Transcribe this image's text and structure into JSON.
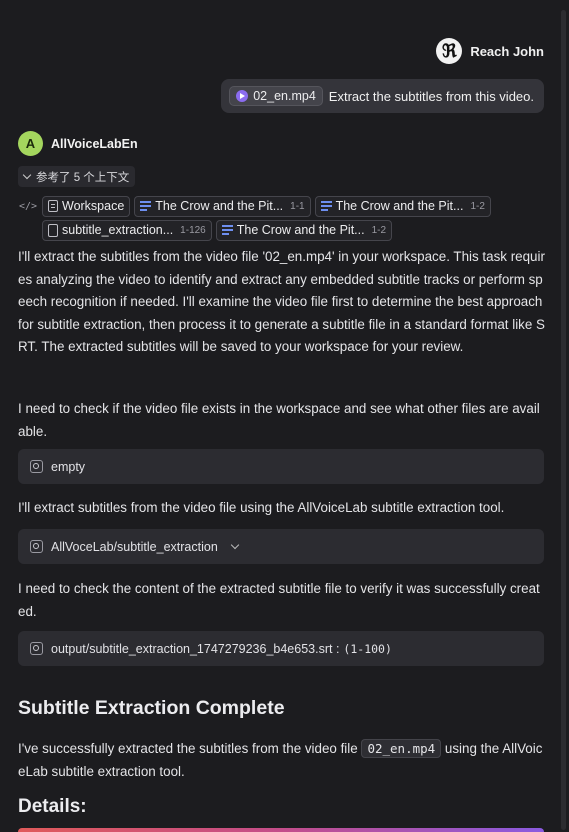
{
  "user": {
    "name": "Reach John",
    "file_chip": "02_en.mp4",
    "message": "Extract the subtitles from this video."
  },
  "assistant": {
    "avatar_letter": "A",
    "name": "AllVoiceLabEn",
    "refs_toggle": "参考了 5 个上下文",
    "refs": [
      {
        "label": "Workspace",
        "range": "",
        "icon": "folder-icon"
      },
      {
        "label": "The Crow and the Pit...",
        "range": "1-1",
        "icon": "text-lines-icon"
      },
      {
        "label": "The Crow and the Pit...",
        "range": "1-2",
        "icon": "text-lines-icon"
      },
      {
        "label": "subtitle_extraction...",
        "range": "1-126",
        "icon": "file-icon"
      },
      {
        "label": "The Crow and the Pit...",
        "range": "1-2",
        "icon": "text-lines-icon"
      }
    ],
    "para1": "I'll extract the subtitles from the video file '02_en.mp4' in your workspace. This task requires analyzing the video to identify and extract any embedded subtitle tracks or perform speech recognition if needed. I'll examine the video file first to determine the best approach for subtitle extraction, then process it to generate a subtitle file in a standard format like SRT. The extracted subtitles will be saved to your workspace for your review.",
    "para2": "I need to check if the video file exists in the workspace and see what other files are available.",
    "tool1": "empty",
    "para3": "I'll extract subtitles from the video file using the AllVoiceLab subtitle extraction tool.",
    "tool2": "AllVoceLab/subtitle_extraction",
    "para4": "I need to check the content of the extracted subtitle file to verify it was successfully created.",
    "tool3_path": "output/subtitle_extraction_1747279236_b4e653.srt :",
    "tool3_range": "(1-100)",
    "heading": "Subtitle Extraction Complete",
    "para5_pre": "I've successfully extracted the subtitles from the video file ",
    "para5_code": "02_en.mp4",
    "para5_post": " using the AllVoiceLab subtitle extraction tool.",
    "details_heading": "Details:"
  }
}
